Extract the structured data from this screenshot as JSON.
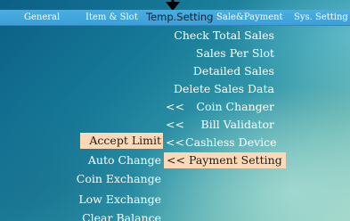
{
  "tabs": [
    {
      "label": "General"
    },
    {
      "label": "Item & Slot"
    },
    {
      "label": "Temp.Setting"
    },
    {
      "label": "Sale&Payment"
    },
    {
      "label": "Sys. Setting"
    }
  ],
  "active_tab": "Temp.Setting",
  "selected_tab": "Sale&Payment",
  "sale_payment_menu": {
    "check_total_sales": "Check Total Sales",
    "sales_per_slot": "Sales Per Slot",
    "detailed_sales": "Detailed Sales",
    "delete_sales_data": "Delete Sales Data",
    "coin_changer": "Coin Changer",
    "bill_validator": "Bill Validator",
    "cashless_device": "Cashless Device",
    "payment_setting": "Payment Setting",
    "submenu_marker": "<<"
  },
  "payment_setting_submenu": {
    "accept_limit": "Accept Limit",
    "auto_change": "Auto Change",
    "coin_exchange": "Coin Exchange",
    "low_exchange": "Low Exchange",
    "clear_balance": "Clear Balance"
  },
  "highlighted_items": [
    "Accept Limit",
    "Payment Setting"
  ]
}
